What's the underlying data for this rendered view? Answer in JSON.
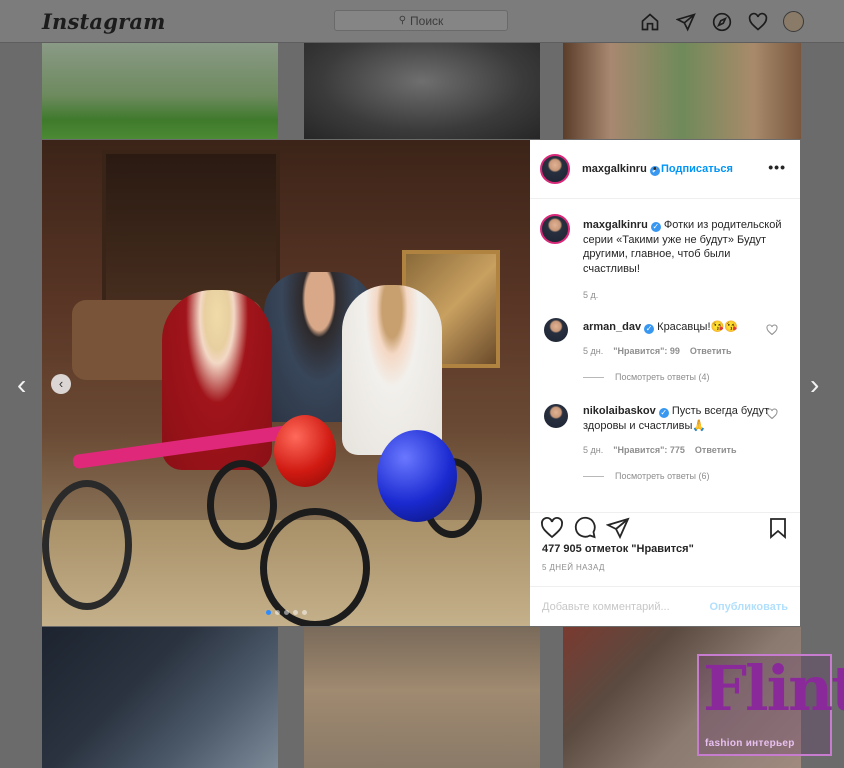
{
  "app": {
    "logo": "Instagram"
  },
  "search": {
    "placeholder": "Поиск"
  },
  "nav": {
    "icons": [
      "home-icon",
      "direct-icon",
      "explore-icon",
      "activity-heart-icon",
      "profile-avatar"
    ]
  },
  "post": {
    "author": "maxgalkinru",
    "follow_label": "Подписаться",
    "separator": "•",
    "more": "•••",
    "caption_user": "maxgalkinru",
    "caption_text": "Фотки из родительской серии «Такими уже не будут» Будут другими, главное, чтоб были счастливы!",
    "caption_time": "5 д.",
    "comments": [
      {
        "user": "arman_dav",
        "text": "Красавцы!😘😘",
        "time": "5 дн.",
        "likes": "\"Нравится\": 99",
        "reply": "Ответить",
        "view_replies": "Посмотреть ответы (4)"
      },
      {
        "user": "nikolaibaskov",
        "text": "Пусть всегда будут здоровы и счастливы🙏",
        "time": "5 дн.",
        "likes": "\"Нравится\": 775",
        "reply": "Ответить",
        "view_replies": "Посмотреть ответы (6)"
      }
    ],
    "likes_text": "477 905 отметок \"Нравится\"",
    "posted_ago": "5 ДНЕЙ НАЗАД",
    "add_comment_placeholder": "Добавьте комментарий...",
    "publish_label": "Опубликовать",
    "carousel": {
      "slides": 5,
      "active": 1
    }
  },
  "navigation": {
    "prev": "‹",
    "next": "›",
    "inphoto_prev": "‹"
  },
  "watermark": {
    "big": "Flint",
    "small": "fashion интерьер"
  },
  "colors": {
    "link": "#0095f6",
    "verified": "#3897f0",
    "text": "#262626",
    "meta": "#8e8e8e"
  }
}
